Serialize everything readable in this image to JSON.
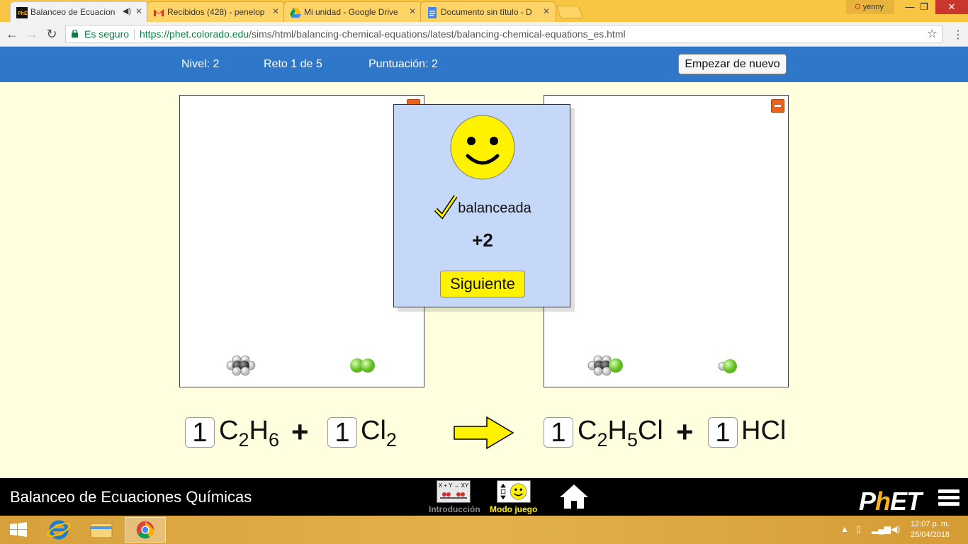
{
  "browser": {
    "tabs": [
      {
        "title": "Balanceo de Ecuacion",
        "active": true
      },
      {
        "title": "Recibidos (428) - penelop"
      },
      {
        "title": "Mi unidad - Google Drive"
      },
      {
        "title": "Documento sin título - D"
      }
    ],
    "user": "yenny",
    "security_label": "Es seguro",
    "url_host": "https://phet.colorado.edu",
    "url_path": "/sims/html/balancing-chemical-equations/latest/balancing-chemical-equations_es.html"
  },
  "sim_header": {
    "level": "Nivel: 2",
    "challenge": "Reto 1 de 5",
    "score": "Puntuación: 2",
    "restart_label": "Empezar de nuevo"
  },
  "feedback": {
    "status": "balanceada",
    "points": "+2",
    "next_label": "Siguiente"
  },
  "equation": {
    "reactants": [
      {
        "coefficient": "1",
        "formula": [
          {
            "t": "C"
          },
          {
            "s": "2"
          },
          {
            "t": "H"
          },
          {
            "s": "6"
          }
        ]
      },
      {
        "coefficient": "1",
        "formula": [
          {
            "t": "Cl"
          },
          {
            "s": "2"
          }
        ]
      }
    ],
    "products": [
      {
        "coefficient": "1",
        "formula": [
          {
            "t": "C"
          },
          {
            "s": "2"
          },
          {
            "t": "H"
          },
          {
            "s": "5"
          },
          {
            "t": "Cl"
          }
        ]
      },
      {
        "coefficient": "1",
        "formula": [
          {
            "t": "HCl"
          }
        ]
      }
    ],
    "plus": "+"
  },
  "navbar": {
    "sim_title": "Balanceo de Ecuaciones Químicas",
    "screens": [
      {
        "label": "Introducción",
        "selected": false,
        "icon_text": "X + Y → XY"
      },
      {
        "label": "Modo juego",
        "selected": true
      }
    ],
    "logo_parts": [
      "P",
      "h",
      "ET"
    ]
  },
  "taskbar": {
    "time": "12:07 p. m.",
    "date": "25/04/2018"
  },
  "colors": {
    "sim_header": "#2F78C9",
    "background": "#FFFFE0",
    "popup": "#C6D8F7",
    "button_yellow": "#FFF200",
    "minus": "#E8631B",
    "chlorine": "#8FE04A"
  }
}
